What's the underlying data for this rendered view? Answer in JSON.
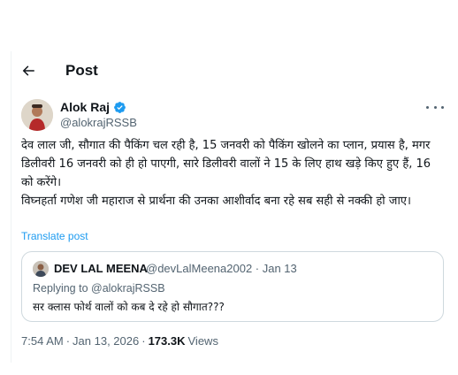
{
  "header": {
    "title": "Post",
    "back_icon": "arrow-left-icon"
  },
  "author": {
    "name": "Alok Raj",
    "handle": "@alokrajRSSB",
    "verified_color": "#1d9bf0"
  },
  "tweet": {
    "text": "देव लाल जी, सौगात की पैकिंग चल रही है, 15 जनवरी को पैकिंग खोलने का प्लान, प्रयास है, मगर डिलीवरी 16 जनवरी को ही हो पाएगी, सारे डिलीवरी वालों ने 15 के लिए हाथ खड़े किए हुए हैं, 16 को करेंगे।\nविघ्नहर्ता गणेश जी महाराज से प्रार्थना की उनका आशीर्वाद बना रहे सब सही से नक्की हो जाए।",
    "translate_label": "Translate post"
  },
  "quote": {
    "name": "DEV LAL MEENA",
    "meta": "@devLalMeena2002 · Jan 13",
    "replying_to": "Replying to @alokrajRSSB",
    "text": "सर क्लास फोर्थ वालों को कब दे रहे हो सौगात???"
  },
  "meta": {
    "time": "7:54 AM",
    "separator": "·",
    "date": "Jan 13, 2026",
    "views_count": "173.3K",
    "views_label": "Views"
  },
  "colors": {
    "accent": "#1d9bf0",
    "secondary_text": "#536471",
    "primary_text": "#0f1419",
    "border": "#cfd9de"
  }
}
